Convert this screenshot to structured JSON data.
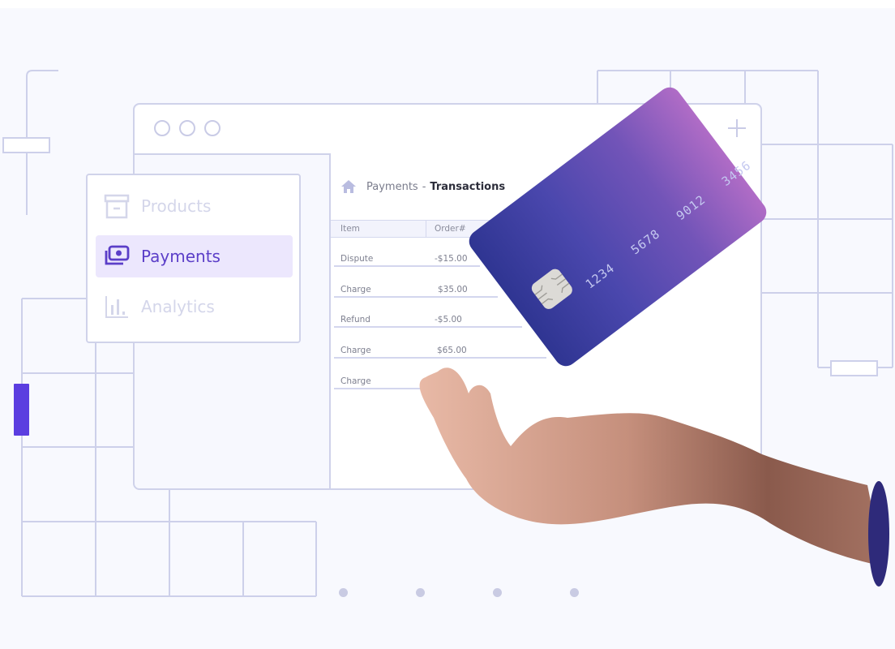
{
  "window": {
    "controls": [
      "circle",
      "circle",
      "circle"
    ],
    "new_tab_icon": "plus-icon"
  },
  "sidebar": {
    "items": [
      {
        "label": "Products",
        "icon": "archive-box-icon",
        "active": false
      },
      {
        "label": "Payments",
        "icon": "money-stack-icon",
        "active": true
      },
      {
        "label": "Analytics",
        "icon": "bar-chart-icon",
        "active": false
      }
    ]
  },
  "breadcrumb": {
    "icon": "home-icon",
    "parent": "Payments",
    "separator": "-",
    "current": "Transactions"
  },
  "table": {
    "columns": [
      "Item",
      "Order#"
    ],
    "rows": [
      {
        "item": "Dispute",
        "amount": "-$15.00"
      },
      {
        "item": "Charge",
        "amount": "$35.00"
      },
      {
        "item": "Refund",
        "amount": "-$5.00"
      },
      {
        "item": "Charge",
        "amount": "$65.00"
      },
      {
        "item": "Charge",
        "amount": ""
      }
    ]
  },
  "card": {
    "number_groups": [
      "1234",
      "5678",
      "9012",
      "3456"
    ],
    "gradient": [
      "#2f3592",
      "#b06cc6"
    ]
  },
  "pager": {
    "dots": 4
  },
  "colors": {
    "accent": "#5b3ee0",
    "active_bg": "#ece7fd",
    "active_text": "#5b3ec8",
    "line": "#cdd0ea",
    "sleeve": "#2e2a7a"
  }
}
